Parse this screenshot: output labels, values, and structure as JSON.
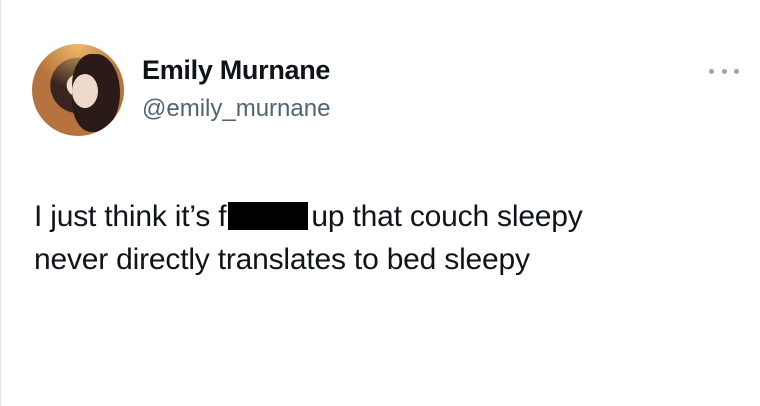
{
  "user": {
    "display_name": "Emily Murnane",
    "handle": "@emily_murnane",
    "avatar_icon": "profile-photo"
  },
  "tweet": {
    "text_part1": "I just think it’s f",
    "text_part2": "up that couch sleepy",
    "text_line2": "never directly translates to bed sleepy",
    "redaction": "censored-word"
  },
  "menu": {
    "more_icon": "more-horizontal-icon"
  },
  "colors": {
    "text": "#0f1419",
    "secondary_text": "#536471",
    "background": "#ffffff"
  }
}
